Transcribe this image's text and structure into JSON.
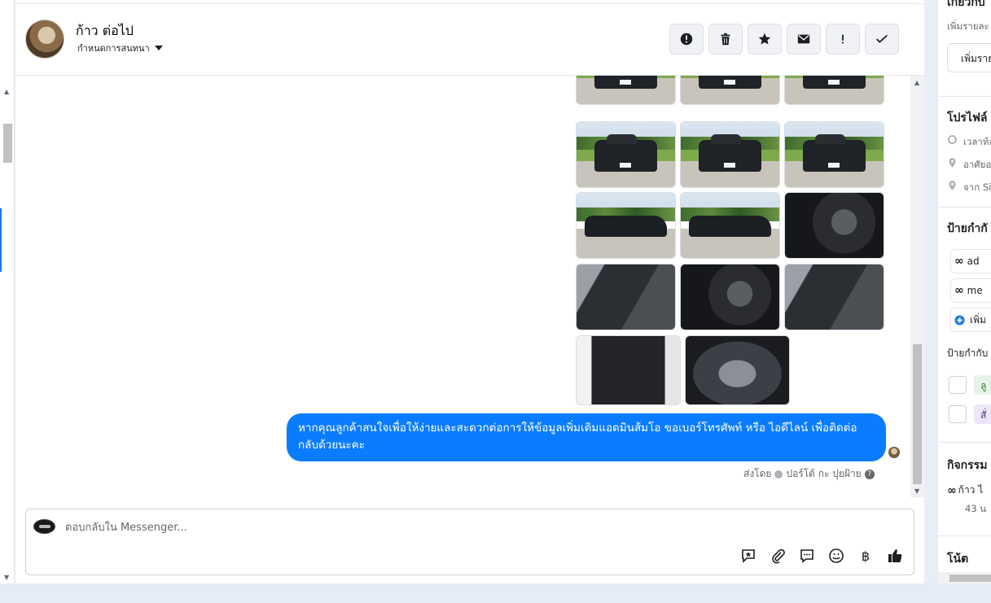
{
  "header": {
    "contact_name": "ก้าว ต่อไป",
    "assign_label": "กำหนดการสนทนา",
    "actions": [
      {
        "name": "spam-button",
        "icon": "alert-circle-icon"
      },
      {
        "name": "delete-button",
        "icon": "trash-icon"
      },
      {
        "name": "star-button",
        "icon": "star-icon"
      },
      {
        "name": "mark-unread-button",
        "icon": "envelope-icon"
      },
      {
        "name": "follow-up-button",
        "icon": "exclamation-icon"
      },
      {
        "name": "mark-done-button",
        "icon": "check-icon"
      }
    ]
  },
  "conversation": {
    "photos": [
      {
        "kind": "rear"
      },
      {
        "kind": "rear"
      },
      {
        "kind": "rear"
      },
      {
        "kind": "rear"
      },
      {
        "kind": "rear"
      },
      {
        "kind": "rear"
      },
      {
        "kind": "side"
      },
      {
        "kind": "side"
      },
      {
        "kind": "interior"
      },
      {
        "kind": "interior2"
      },
      {
        "kind": "interior"
      },
      {
        "kind": "interior2"
      },
      {
        "kind": "door"
      },
      {
        "kind": "engine"
      }
    ],
    "message": "หากคุณลูกค้าสนใจเพื่อให้ง่ายและสะดวกต่อการให้ข้อมูลเพิ่มเติมแอดมินส้มโอ ขอเบอร์โทรศัพท์ หรือ ไอดีไลน์ เพื่อติดต่อกลับด้วยนะคะ",
    "sent_by_prefix": "ส่งโดย",
    "sent_by_name": "ปอร์โต้ กะ ปุยฝ้าย"
  },
  "composer": {
    "placeholder": "ตอบกลับใน Messenger...",
    "tools": [
      "saved-reply-icon",
      "paperclip-icon",
      "chat-bubble-icon",
      "emoji-icon",
      "baht-icon",
      "thumbs-up-icon"
    ],
    "baht_symbol": "฿"
  },
  "sidebar": {
    "about_heading": "เกี่ยวกับ",
    "add_details_hint": "เพิ่มรายละ",
    "add_details_button": "เพิ่มราย",
    "profile_heading": "โปรไฟล์",
    "profile_items": [
      "เวลาท้อ",
      "อาศัยอ",
      "จาก Sis"
    ],
    "labels_heading": "ป้ายกำกั",
    "labels": [
      "ad",
      "me"
    ],
    "add_label": "เพิ่ม",
    "labels_sub_heading": "ป้ายกำกับ",
    "tags": [
      {
        "text": "ลู",
        "bg": "#e7f3e8",
        "color": "#2e7d32"
      },
      {
        "text": "สั่",
        "bg": "#ece6f7",
        "color": "#4a3a7a"
      }
    ],
    "activity_heading": "กิจกรรม",
    "activity_name": "ก้าว ไ",
    "activity_time": "43 น",
    "notes_heading": "โน้ต"
  },
  "colors": {
    "accent": "#0a7cff",
    "brand_blue": "#1877f2"
  }
}
